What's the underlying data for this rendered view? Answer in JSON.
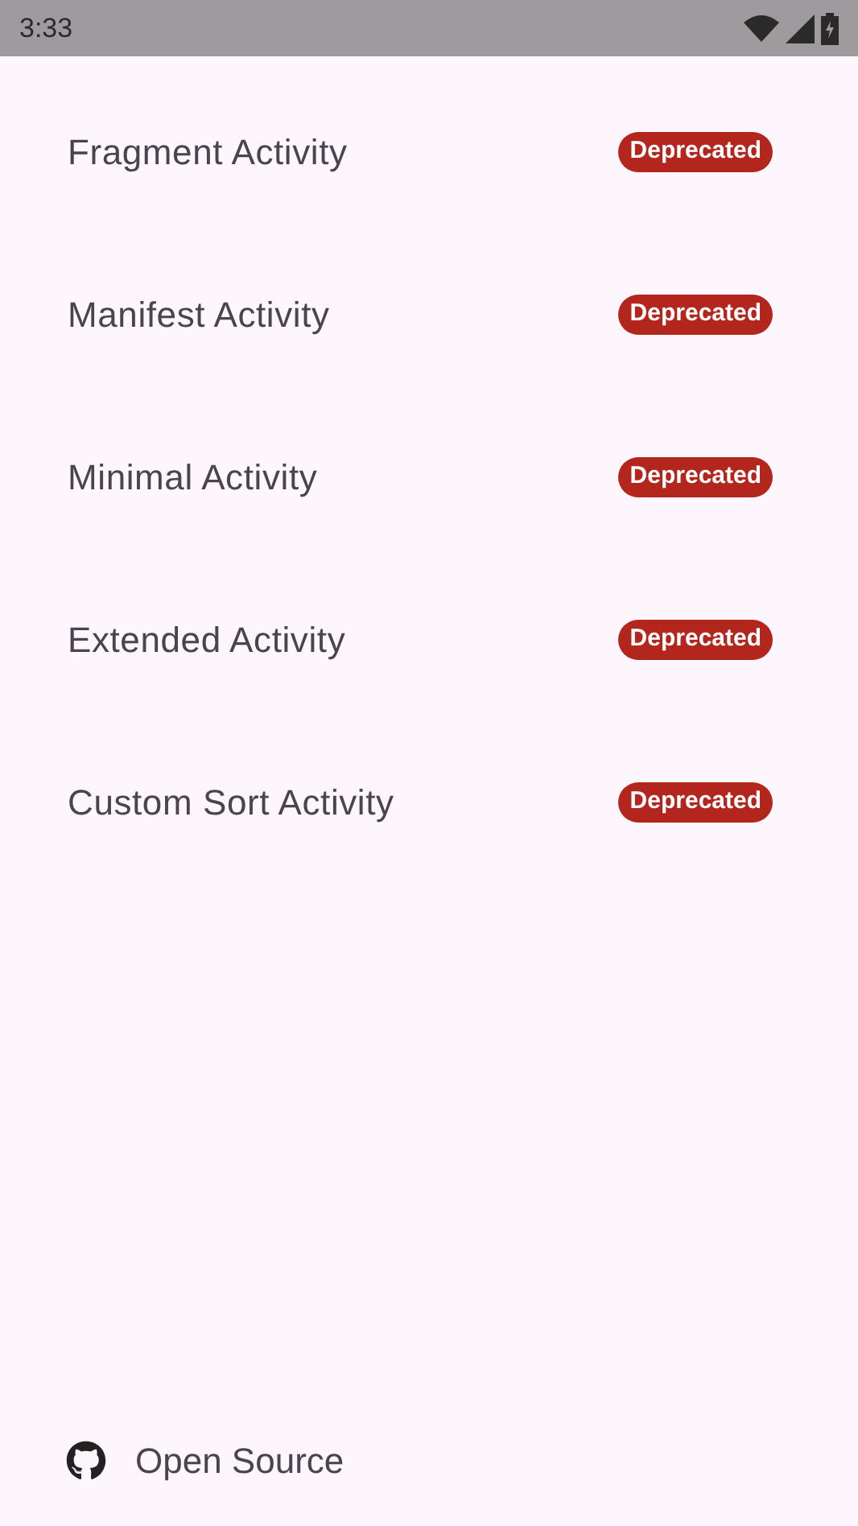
{
  "status_bar": {
    "time": "3:33"
  },
  "items": [
    {
      "title": "Fragment Activity",
      "badge": "Deprecated"
    },
    {
      "title": "Manifest Activity",
      "badge": "Deprecated"
    },
    {
      "title": "Minimal Activity",
      "badge": "Deprecated"
    },
    {
      "title": "Extended Activity",
      "badge": "Deprecated"
    },
    {
      "title": "Custom Sort Activity",
      "badge": "Deprecated"
    }
  ],
  "footer": {
    "label": "Open Source"
  }
}
